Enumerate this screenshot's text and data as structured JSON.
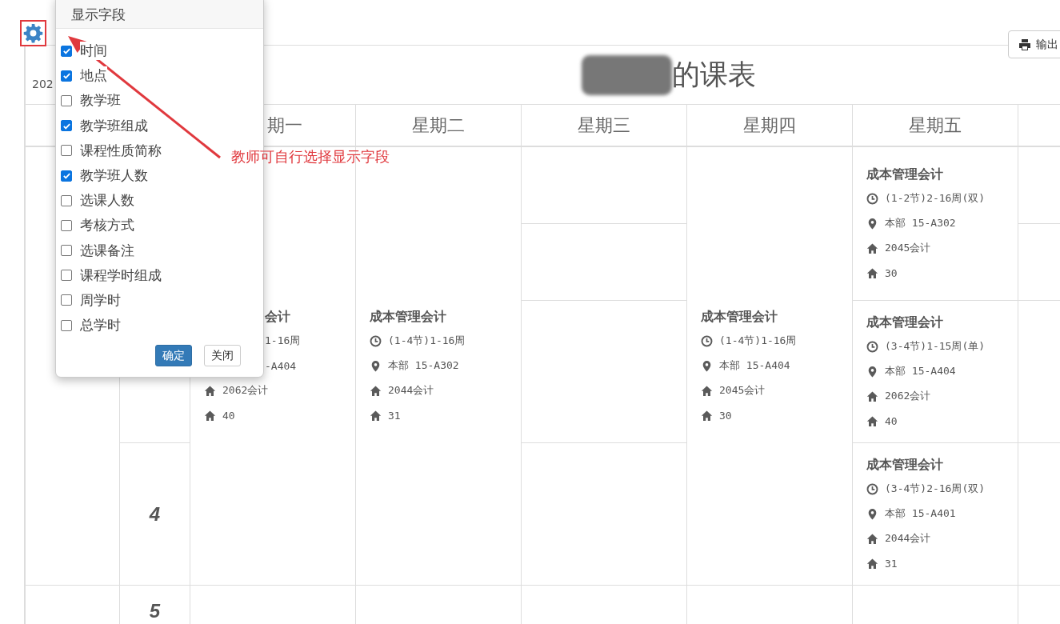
{
  "export_button": {
    "label": "输出"
  },
  "term_label": "202",
  "title": "的课表",
  "header": {
    "days": [
      "期一",
      "星期二",
      "星期三",
      "星期四",
      "星期五"
    ]
  },
  "nodes": [
    "4",
    "5"
  ],
  "days": [
    {
      "cells": [
        {
          "kind": "course",
          "covered": true,
          "title": "会计",
          "lines": [
            {
              "text": "1-16周"
            },
            {
              "text": "-A404"
            },
            {
              "kind": "class",
              "text": "2062会计"
            },
            {
              "kind": "count",
              "text": "40"
            }
          ]
        }
      ]
    },
    {
      "cells": [
        {
          "kind": "course",
          "covered": false,
          "title": "成本管理会计",
          "lines": [
            {
              "kind": "time",
              "text": "(1-4节)1-16周"
            },
            {
              "kind": "place",
              "text": "本部 15-A302"
            },
            {
              "kind": "class",
              "text": "2044会计"
            },
            {
              "kind": "count",
              "text": "31"
            }
          ]
        }
      ]
    },
    {
      "cells": [
        {
          "kind": "empty"
        },
        {
          "kind": "empty"
        },
        {
          "kind": "empty"
        },
        {
          "kind": "empty"
        }
      ]
    },
    {
      "cells": [
        {
          "kind": "course",
          "covered": false,
          "title": "成本管理会计",
          "lines": [
            {
              "kind": "time",
              "text": "(1-4节)1-16周"
            },
            {
              "kind": "place",
              "text": "本部 15-A404"
            },
            {
              "kind": "class",
              "text": "2045会计"
            },
            {
              "kind": "count",
              "text": "30"
            }
          ]
        }
      ]
    },
    {
      "cells": [
        {
          "kind": "course",
          "covered": false,
          "title": "成本管理会计",
          "lines": [
            {
              "kind": "time",
              "text": "(1-2节)2-16周(双)"
            },
            {
              "kind": "place",
              "text": "本部 15-A302"
            },
            {
              "kind": "class",
              "text": "2045会计"
            },
            {
              "kind": "count",
              "text": "30"
            }
          ]
        },
        {
          "kind": "course",
          "covered": false,
          "title": "成本管理会计",
          "lines": [
            {
              "kind": "time",
              "text": "(3-4节)1-15周(单)"
            },
            {
              "kind": "place",
              "text": "本部 15-A404"
            },
            {
              "kind": "class",
              "text": "2062会计"
            },
            {
              "kind": "count",
              "text": "40"
            }
          ]
        },
        {
          "kind": "course",
          "covered": false,
          "title": "成本管理会计",
          "lines": [
            {
              "kind": "time",
              "text": "(3-4节)2-16周(双)"
            },
            {
              "kind": "place",
              "text": "本部 15-A401"
            },
            {
              "kind": "class",
              "text": "2044会计"
            },
            {
              "kind": "count",
              "text": "31"
            }
          ]
        }
      ]
    }
  ],
  "field_popup": {
    "title": "显示字段",
    "fields": [
      {
        "label": "时间",
        "checked": true
      },
      {
        "label": "地点",
        "checked": true
      },
      {
        "label": "教学班",
        "checked": false
      },
      {
        "label": "教学班组成",
        "checked": true
      },
      {
        "label": "课程性质简称",
        "checked": false
      },
      {
        "label": "教学班人数",
        "checked": true
      },
      {
        "label": "选课人数",
        "checked": false
      },
      {
        "label": "考核方式",
        "checked": false
      },
      {
        "label": "选课备注",
        "checked": false
      },
      {
        "label": "课程学时组成",
        "checked": false
      },
      {
        "label": "周学时",
        "checked": false
      },
      {
        "label": "总学时",
        "checked": false
      }
    ],
    "confirm_button": "确定",
    "close_button": "关闭"
  },
  "annotation": {
    "text": "教师可自行选择显示字段"
  }
}
